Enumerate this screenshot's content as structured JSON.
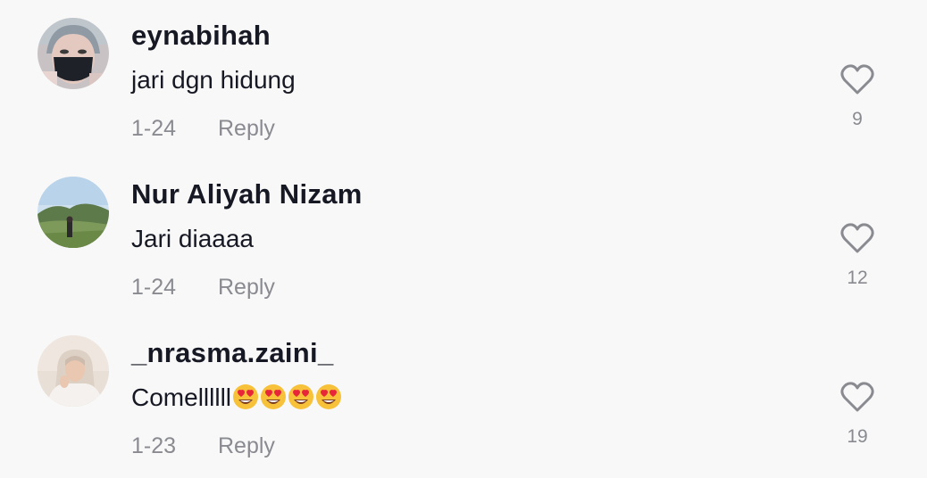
{
  "comments": [
    {
      "username": "eynabihah",
      "text": "jari dgn hidung",
      "date": "1-24",
      "reply_label": "Reply",
      "likes": "9",
      "avatar_icon": "avatar-masked-woman"
    },
    {
      "username": "Nur Aliyah Nizam",
      "text": "Jari diaaaa",
      "date": "1-24",
      "reply_label": "Reply",
      "likes": "12",
      "avatar_icon": "avatar-landscape"
    },
    {
      "username": "_nrasma.zaini_",
      "text": "Comellllll",
      "emojis": [
        "heart-eyes-emoji",
        "heart-eyes-emoji",
        "heart-eyes-emoji",
        "heart-eyes-emoji"
      ],
      "date": "1-23",
      "reply_label": "Reply",
      "likes": "19",
      "avatar_icon": "avatar-hijab-woman"
    }
  ],
  "colors": {
    "background": "#f8f8f8",
    "username": "#161823",
    "secondary": "#8a8b91"
  }
}
